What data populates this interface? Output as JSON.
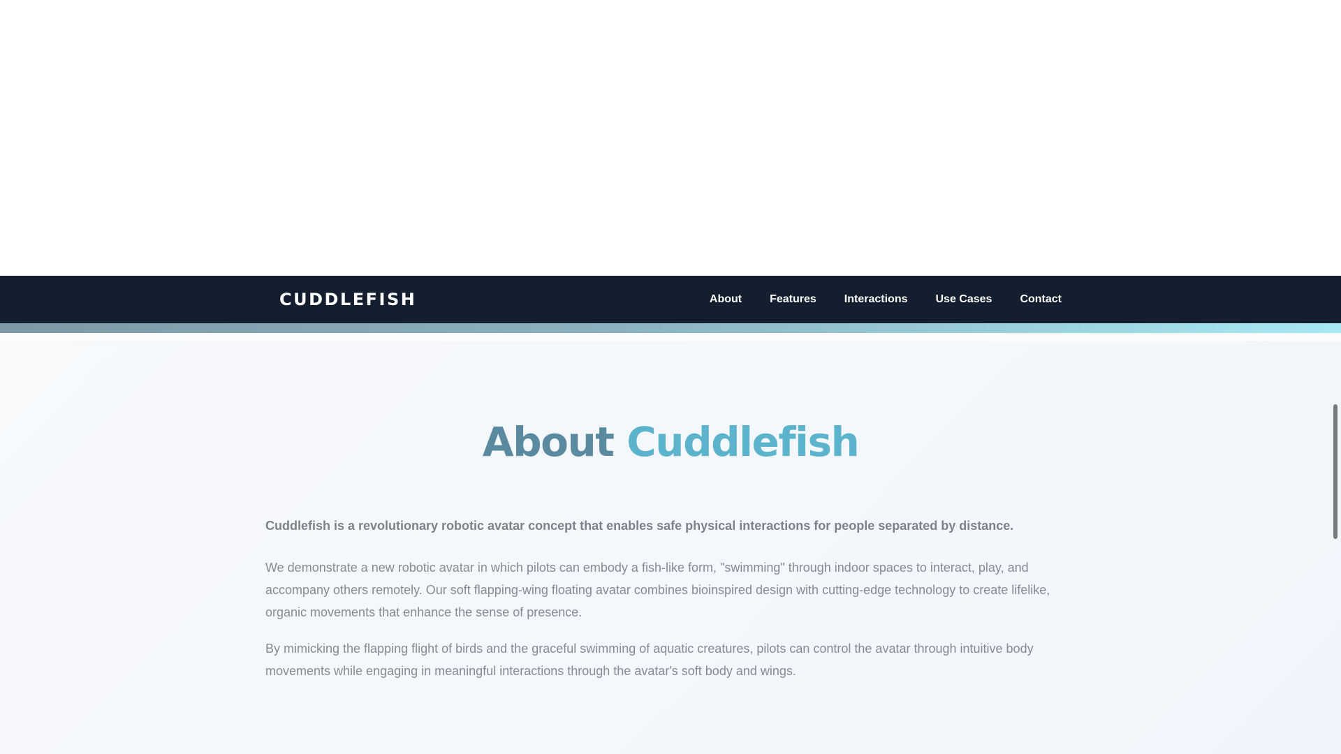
{
  "nav": {
    "logo": "CUDDLEFISH",
    "links": [
      "About",
      "Features",
      "Interactions",
      "Use Cases",
      "Contact"
    ]
  },
  "about": {
    "title_part1": "About",
    "title_part2": "Cuddlefish",
    "lead": "Cuddlefish is a revolutionary robotic avatar concept that enables safe physical interactions for people separated by distance.",
    "paragraphs": [
      "We demonstrate a new robotic avatar in which pilots can embody a fish-like form, \"swimming\" through indoor spaces to interact, play, and accompany others remotely. Our soft flapping-wing floating avatar combines bioinspired design with cutting-edge technology to create lifelike, organic movements that enhance the sense of presence.",
      "By mimicking the flapping flight of birds and the graceful swimming of aquatic creatures, pilots can control the avatar through intuitive body movements while engaging in meaningful interactions through the avatar's soft body and wings."
    ]
  },
  "colors": {
    "nav_background": "#131f2f",
    "title_dark": "#5a8a9f",
    "title_light": "#5bb4cc",
    "body_text": "#868b91"
  }
}
